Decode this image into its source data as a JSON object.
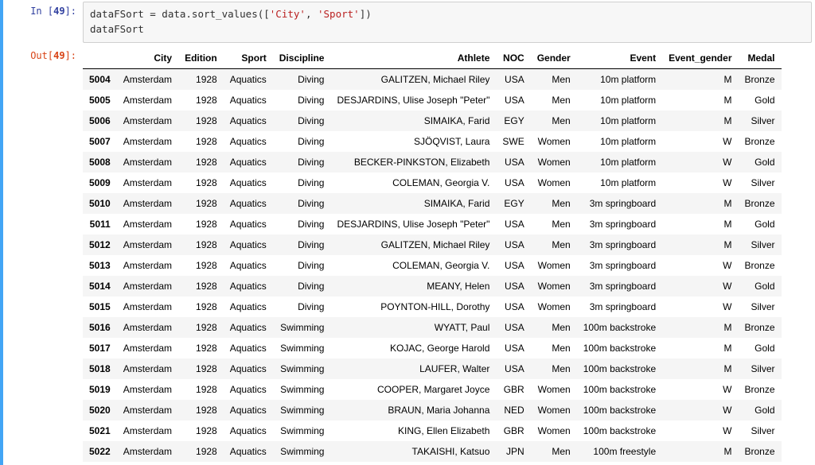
{
  "in_prompt_prefix": "In [",
  "in_prompt_num": "49",
  "in_prompt_suffix": "]:",
  "out_prompt_prefix": "Out[",
  "out_prompt_num": "49",
  "out_prompt_suffix": "]:",
  "code": {
    "line1_pre": "dataFSort = data.sort_values([",
    "str1": "'City'",
    "sep": ", ",
    "str2": "'Sport'",
    "line1_post": "])",
    "line2": "dataFSort"
  },
  "columns": [
    "",
    "City",
    "Edition",
    "Sport",
    "Discipline",
    "Athlete",
    "NOC",
    "Gender",
    "Event",
    "Event_gender",
    "Medal"
  ],
  "rows": [
    {
      "idx": "5004",
      "City": "Amsterdam",
      "Edition": "1928",
      "Sport": "Aquatics",
      "Discipline": "Diving",
      "Athlete": "GALITZEN, Michael Riley",
      "NOC": "USA",
      "Gender": "Men",
      "Event": "10m platform",
      "Event_gender": "M",
      "Medal": "Bronze"
    },
    {
      "idx": "5005",
      "City": "Amsterdam",
      "Edition": "1928",
      "Sport": "Aquatics",
      "Discipline": "Diving",
      "Athlete": "DESJARDINS, Ulise Joseph \"Peter\"",
      "NOC": "USA",
      "Gender": "Men",
      "Event": "10m platform",
      "Event_gender": "M",
      "Medal": "Gold"
    },
    {
      "idx": "5006",
      "City": "Amsterdam",
      "Edition": "1928",
      "Sport": "Aquatics",
      "Discipline": "Diving",
      "Athlete": "SIMAIKA, Farid",
      "NOC": "EGY",
      "Gender": "Men",
      "Event": "10m platform",
      "Event_gender": "M",
      "Medal": "Silver"
    },
    {
      "idx": "5007",
      "City": "Amsterdam",
      "Edition": "1928",
      "Sport": "Aquatics",
      "Discipline": "Diving",
      "Athlete": "SJÖQVIST, Laura",
      "NOC": "SWE",
      "Gender": "Women",
      "Event": "10m platform",
      "Event_gender": "W",
      "Medal": "Bronze"
    },
    {
      "idx": "5008",
      "City": "Amsterdam",
      "Edition": "1928",
      "Sport": "Aquatics",
      "Discipline": "Diving",
      "Athlete": "BECKER-PINKSTON, Elizabeth",
      "NOC": "USA",
      "Gender": "Women",
      "Event": "10m platform",
      "Event_gender": "W",
      "Medal": "Gold"
    },
    {
      "idx": "5009",
      "City": "Amsterdam",
      "Edition": "1928",
      "Sport": "Aquatics",
      "Discipline": "Diving",
      "Athlete": "COLEMAN, Georgia V.",
      "NOC": "USA",
      "Gender": "Women",
      "Event": "10m platform",
      "Event_gender": "W",
      "Medal": "Silver"
    },
    {
      "idx": "5010",
      "City": "Amsterdam",
      "Edition": "1928",
      "Sport": "Aquatics",
      "Discipline": "Diving",
      "Athlete": "SIMAIKA, Farid",
      "NOC": "EGY",
      "Gender": "Men",
      "Event": "3m springboard",
      "Event_gender": "M",
      "Medal": "Bronze"
    },
    {
      "idx": "5011",
      "City": "Amsterdam",
      "Edition": "1928",
      "Sport": "Aquatics",
      "Discipline": "Diving",
      "Athlete": "DESJARDINS, Ulise Joseph \"Peter\"",
      "NOC": "USA",
      "Gender": "Men",
      "Event": "3m springboard",
      "Event_gender": "M",
      "Medal": "Gold"
    },
    {
      "idx": "5012",
      "City": "Amsterdam",
      "Edition": "1928",
      "Sport": "Aquatics",
      "Discipline": "Diving",
      "Athlete": "GALITZEN, Michael Riley",
      "NOC": "USA",
      "Gender": "Men",
      "Event": "3m springboard",
      "Event_gender": "M",
      "Medal": "Silver"
    },
    {
      "idx": "5013",
      "City": "Amsterdam",
      "Edition": "1928",
      "Sport": "Aquatics",
      "Discipline": "Diving",
      "Athlete": "COLEMAN, Georgia V.",
      "NOC": "USA",
      "Gender": "Women",
      "Event": "3m springboard",
      "Event_gender": "W",
      "Medal": "Bronze"
    },
    {
      "idx": "5014",
      "City": "Amsterdam",
      "Edition": "1928",
      "Sport": "Aquatics",
      "Discipline": "Diving",
      "Athlete": "MEANY, Helen",
      "NOC": "USA",
      "Gender": "Women",
      "Event": "3m springboard",
      "Event_gender": "W",
      "Medal": "Gold"
    },
    {
      "idx": "5015",
      "City": "Amsterdam",
      "Edition": "1928",
      "Sport": "Aquatics",
      "Discipline": "Diving",
      "Athlete": "POYNTON-HILL, Dorothy",
      "NOC": "USA",
      "Gender": "Women",
      "Event": "3m springboard",
      "Event_gender": "W",
      "Medal": "Silver"
    },
    {
      "idx": "5016",
      "City": "Amsterdam",
      "Edition": "1928",
      "Sport": "Aquatics",
      "Discipline": "Swimming",
      "Athlete": "WYATT, Paul",
      "NOC": "USA",
      "Gender": "Men",
      "Event": "100m backstroke",
      "Event_gender": "M",
      "Medal": "Bronze"
    },
    {
      "idx": "5017",
      "City": "Amsterdam",
      "Edition": "1928",
      "Sport": "Aquatics",
      "Discipline": "Swimming",
      "Athlete": "KOJAC, George Harold",
      "NOC": "USA",
      "Gender": "Men",
      "Event": "100m backstroke",
      "Event_gender": "M",
      "Medal": "Gold"
    },
    {
      "idx": "5018",
      "City": "Amsterdam",
      "Edition": "1928",
      "Sport": "Aquatics",
      "Discipline": "Swimming",
      "Athlete": "LAUFER, Walter",
      "NOC": "USA",
      "Gender": "Men",
      "Event": "100m backstroke",
      "Event_gender": "M",
      "Medal": "Silver"
    },
    {
      "idx": "5019",
      "City": "Amsterdam",
      "Edition": "1928",
      "Sport": "Aquatics",
      "Discipline": "Swimming",
      "Athlete": "COOPER, Margaret Joyce",
      "NOC": "GBR",
      "Gender": "Women",
      "Event": "100m backstroke",
      "Event_gender": "W",
      "Medal": "Bronze"
    },
    {
      "idx": "5020",
      "City": "Amsterdam",
      "Edition": "1928",
      "Sport": "Aquatics",
      "Discipline": "Swimming",
      "Athlete": "BRAUN, Maria Johanna",
      "NOC": "NED",
      "Gender": "Women",
      "Event": "100m backstroke",
      "Event_gender": "W",
      "Medal": "Gold"
    },
    {
      "idx": "5021",
      "City": "Amsterdam",
      "Edition": "1928",
      "Sport": "Aquatics",
      "Discipline": "Swimming",
      "Athlete": "KING, Ellen Elizabeth",
      "NOC": "GBR",
      "Gender": "Women",
      "Event": "100m backstroke",
      "Event_gender": "W",
      "Medal": "Silver"
    },
    {
      "idx": "5022",
      "City": "Amsterdam",
      "Edition": "1928",
      "Sport": "Aquatics",
      "Discipline": "Swimming",
      "Athlete": "TAKAISHI, Katsuo",
      "NOC": "JPN",
      "Gender": "Men",
      "Event": "100m freestyle",
      "Event_gender": "M",
      "Medal": "Bronze"
    }
  ]
}
